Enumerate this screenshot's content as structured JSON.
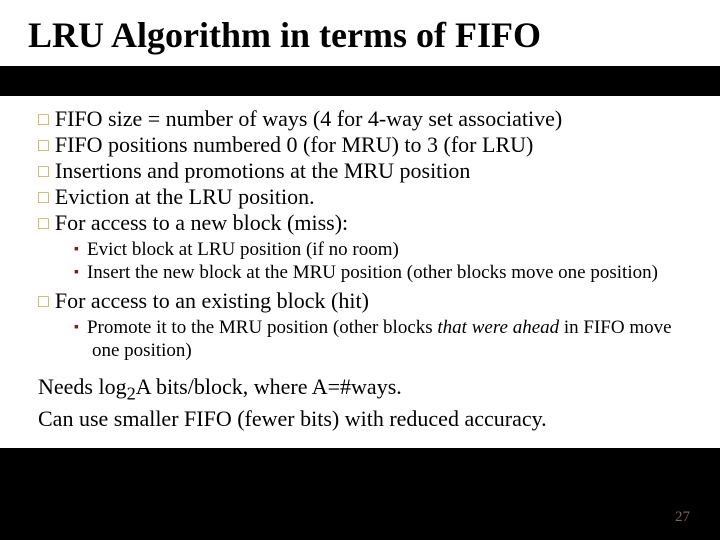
{
  "title": "LRU Algorithm in terms of FIFO",
  "bullets": {
    "b0": "FIFO size = number of ways (4 for 4-way set associative)",
    "b1": "FIFO positions numbered 0 (for MRU) to 3 (for LRU)",
    "b2": "Insertions and promotions at the MRU position",
    "b3": "Eviction at the LRU position.",
    "b4": "For access to a new block (miss):",
    "b5": "For access to an existing block (hit)"
  },
  "sub_miss": {
    "s0": "Evict block at LRU position (if no room)",
    "s1": "Insert the new block at the MRU position (other blocks move one position)"
  },
  "sub_hit": {
    "s0_prefix": "Promote it to the MRU position (other blocks ",
    "s0_italic": "that were ahead",
    "s0_suffix": " in FIFO move one position)"
  },
  "footer": {
    "line_prefix": "Needs log",
    "line_sub": "2",
    "line_suffix": "A bits/block, where A=#ways.",
    "line2": "Can use smaller FIFO (fewer bits) with reduced accuracy."
  },
  "page_number": "27"
}
